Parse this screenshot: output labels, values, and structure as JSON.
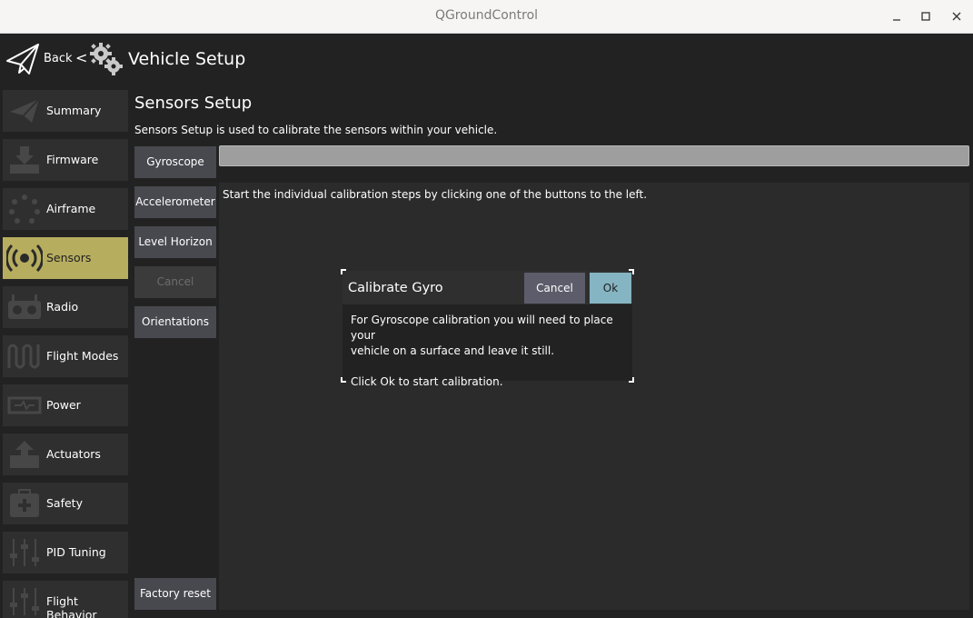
{
  "window": {
    "title": "QGroundControl",
    "controls": [
      "minimize-icon",
      "maximize-icon",
      "close-icon"
    ]
  },
  "header": {
    "back_label": "Back",
    "separator": "<",
    "title": "Vehicle Setup"
  },
  "sidebar": {
    "items": [
      {
        "label": "Summary",
        "icon": "paper-plane-icon"
      },
      {
        "label": "Firmware",
        "icon": "firmware-download-icon"
      },
      {
        "label": "Airframe",
        "icon": "airframe-icon"
      },
      {
        "label": "Sensors",
        "icon": "sensors-icon",
        "active": true
      },
      {
        "label": "Radio",
        "icon": "radio-transmitter-icon"
      },
      {
        "label": "Flight Modes",
        "icon": "flight-modes-icon"
      },
      {
        "label": "Power",
        "icon": "power-icon"
      },
      {
        "label": "Actuators",
        "icon": "actuators-icon"
      },
      {
        "label": "Safety",
        "icon": "safety-icon"
      },
      {
        "label": "PID Tuning",
        "icon": "sliders-icon"
      },
      {
        "label": "Flight Behavior",
        "icon": "sliders-icon"
      }
    ],
    "active_color": "#b7ad5f"
  },
  "main": {
    "title": "Sensors Setup",
    "description": "Sensors Setup is used to calibrate the sensors within your vehicle.",
    "buttons": {
      "gyroscope": "Gyroscope",
      "accelerometer": "Accelerometer",
      "level_horizon": "Level Horizon",
      "cancel": "Cancel",
      "orientations": "Orientations",
      "factory_reset": "Factory reset"
    },
    "instruction": "Start the individual calibration steps by clicking one of the buttons to the left."
  },
  "dialog": {
    "title": "Calibrate Gyro",
    "cancel_label": "Cancel",
    "ok_label": "Ok",
    "body_line1": "For Gyroscope calibration you will need to place your",
    "body_line2": "vehicle on a surface and leave it still.",
    "body_line3": "Click Ok to start calibration."
  },
  "colors": {
    "accent_ok": "#85b4c2",
    "cancel_button": "#5c5c6a"
  }
}
